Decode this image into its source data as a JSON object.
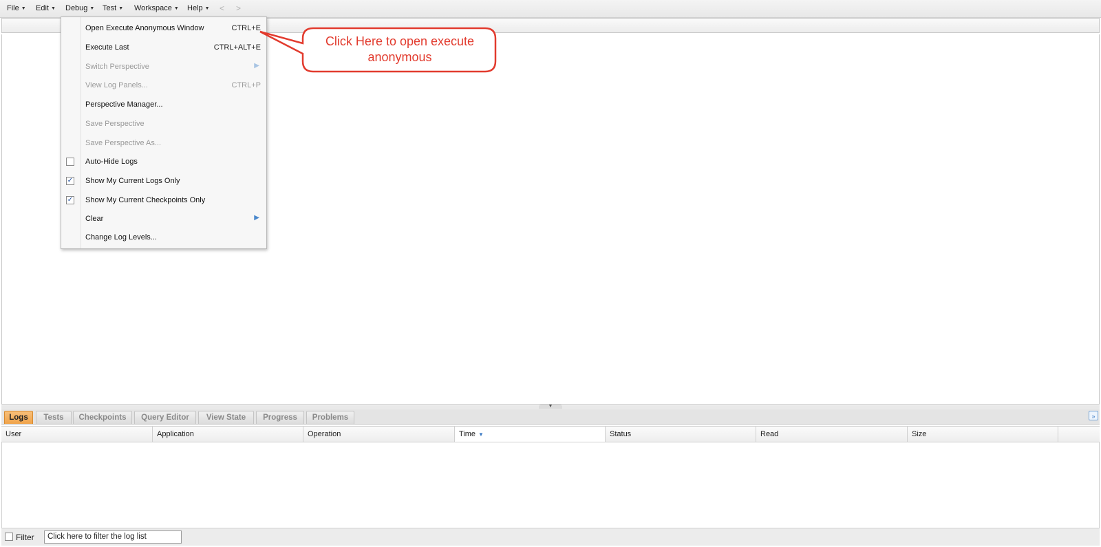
{
  "menubar": {
    "items": [
      {
        "label": "File"
      },
      {
        "label": "Edit"
      },
      {
        "label": "Debug"
      },
      {
        "label": "Test"
      },
      {
        "label": "Workspace"
      },
      {
        "label": "Help"
      }
    ],
    "back_glyph": "<",
    "forward_glyph": ">"
  },
  "debug_menu": {
    "items": [
      {
        "label": "Open Execute Anonymous Window",
        "shortcut": "CTRL+E",
        "enabled": true
      },
      {
        "label": "Execute Last",
        "shortcut": "CTRL+ALT+E",
        "enabled": true
      },
      {
        "label": "Switch Perspective",
        "submenu": true,
        "enabled": false
      },
      {
        "label": "View Log Panels...",
        "shortcut": "CTRL+P",
        "enabled": false
      },
      {
        "label": "Perspective Manager...",
        "enabled": true
      },
      {
        "label": "Save Perspective",
        "enabled": false
      },
      {
        "label": "Save Perspective As...",
        "enabled": false
      },
      {
        "label": "Auto-Hide Logs",
        "checkbox": true,
        "checked": false,
        "enabled": true
      },
      {
        "label": "Show My Current Logs Only",
        "checkbox": true,
        "checked": true,
        "enabled": true
      },
      {
        "label": "Show My Current Checkpoints Only",
        "checkbox": true,
        "checked": true,
        "enabled": true
      },
      {
        "label": "Clear",
        "submenu": true,
        "enabled": true
      },
      {
        "label": "Change Log Levels...",
        "enabled": true
      }
    ]
  },
  "callout": {
    "line1": "Click Here to open execute",
    "line2": "anonymous",
    "color": "#e23b2e"
  },
  "bottom_panel": {
    "tabs": [
      {
        "label": "Logs",
        "active": true
      },
      {
        "label": "Tests"
      },
      {
        "label": "Checkpoints"
      },
      {
        "label": "Query Editor"
      },
      {
        "label": "View State"
      },
      {
        "label": "Progress"
      },
      {
        "label": "Problems"
      }
    ],
    "columns": [
      {
        "label": "User"
      },
      {
        "label": "Application"
      },
      {
        "label": "Operation"
      },
      {
        "label": "Time",
        "sorted": "desc"
      },
      {
        "label": "Status"
      },
      {
        "label": "Read"
      },
      {
        "label": "Size"
      }
    ],
    "filter": {
      "label": "Filter",
      "placeholder": "Click here to filter the log list",
      "checked": false
    }
  },
  "colors": {
    "active_tab": "#f0a34a",
    "accent_blue": "#3d7bc4",
    "callout_red": "#e23b2e"
  }
}
